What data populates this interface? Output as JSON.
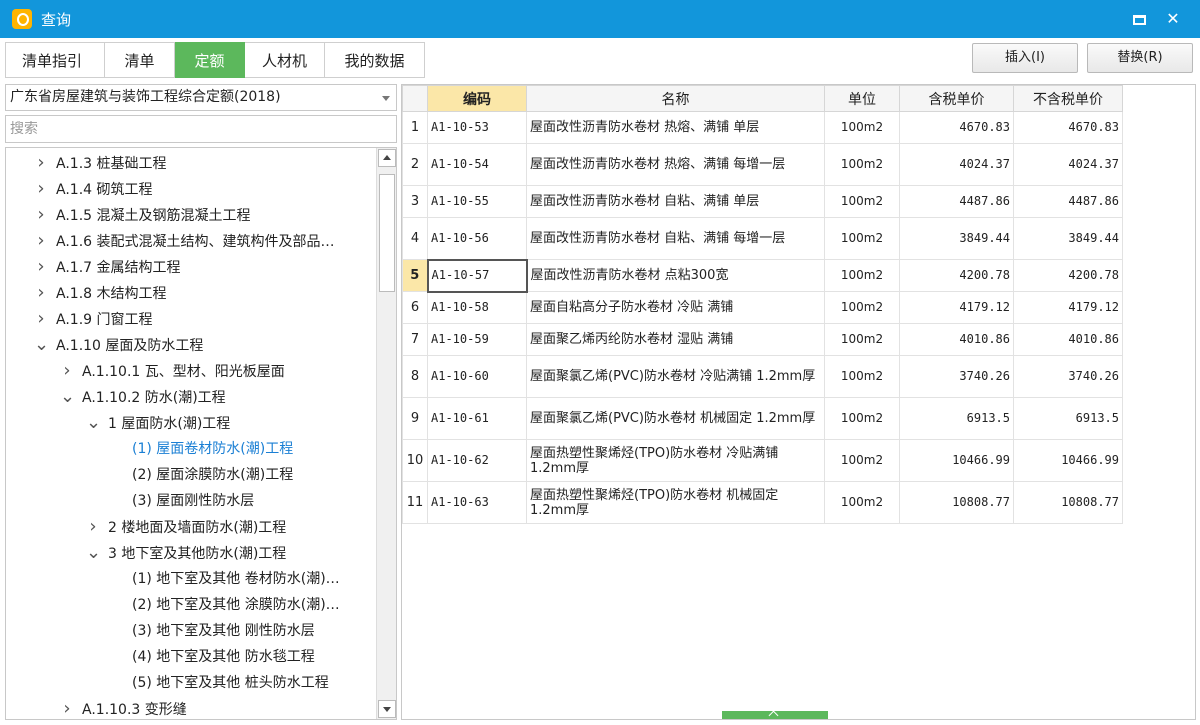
{
  "window": {
    "title": "查询"
  },
  "tabs": [
    {
      "label": "清单指引",
      "active": false
    },
    {
      "label": "清单",
      "active": false
    },
    {
      "label": "定额",
      "active": true
    },
    {
      "label": "人材机",
      "active": false
    },
    {
      "label": "我的数据",
      "active": false
    }
  ],
  "toolbar": {
    "insert_label": "插入(I)",
    "replace_label": "替换(R)"
  },
  "left": {
    "library": "广东省房屋建筑与装饰工程综合定额(2018)",
    "search_placeholder": "搜索",
    "tree": [
      {
        "label": "A.1.3 桩基础工程",
        "state": "collapsed"
      },
      {
        "label": "A.1.4 砌筑工程",
        "state": "collapsed"
      },
      {
        "label": "A.1.5 混凝土及钢筋混凝土工程",
        "state": "collapsed"
      },
      {
        "label": "A.1.6 装配式混凝土结构、建筑构件及部品…",
        "state": "collapsed"
      },
      {
        "label": "A.1.7 金属结构工程",
        "state": "collapsed"
      },
      {
        "label": "A.1.8 木结构工程",
        "state": "collapsed"
      },
      {
        "label": "A.1.9 门窗工程",
        "state": "collapsed"
      },
      {
        "label": "A.1.10 屋面及防水工程",
        "state": "expanded"
      },
      {
        "label": "A.1.10.1 瓦、型材、阳光板屋面",
        "state": "collapsed"
      },
      {
        "label": "A.1.10.2 防水(潮)工程",
        "state": "expanded"
      },
      {
        "label": "1 屋面防水(潮)工程",
        "state": "expanded"
      },
      {
        "label": "(1) 屋面卷材防水(潮)工程",
        "state": "leaf",
        "selected": true
      },
      {
        "label": "(2) 屋面涂膜防水(潮)工程",
        "state": "leaf"
      },
      {
        "label": "(3) 屋面刚性防水层",
        "state": "leaf"
      },
      {
        "label": "2 楼地面及墙面防水(潮)工程",
        "state": "collapsed"
      },
      {
        "label": "3 地下室及其他防水(潮)工程",
        "state": "expanded"
      },
      {
        "label": "(1) 地下室及其他 卷材防水(潮)…",
        "state": "leaf"
      },
      {
        "label": "(2) 地下室及其他 涂膜防水(潮)…",
        "state": "leaf"
      },
      {
        "label": "(3) 地下室及其他 刚性防水层",
        "state": "leaf"
      },
      {
        "label": "(4) 地下室及其他 防水毯工程",
        "state": "leaf"
      },
      {
        "label": "(5) 地下室及其他 桩头防水工程",
        "state": "leaf"
      },
      {
        "label": "A.1.10.3 变形缝",
        "state": "collapsed"
      }
    ]
  },
  "table": {
    "headers": [
      "",
      "编码",
      "名称",
      "单位",
      "含税单价",
      "不含税单价"
    ],
    "rows": [
      {
        "n": "1",
        "code": "A1-10-53",
        "name": "屋面改性沥青防水卷材 热熔、满铺 单层",
        "unit": "100m2",
        "tax": "4670.83",
        "notax": "4670.83"
      },
      {
        "n": "2",
        "code": "A1-10-54",
        "name": "屋面改性沥青防水卷材 热熔、满铺 每增一层",
        "unit": "100m2",
        "tax": "4024.37",
        "notax": "4024.37"
      },
      {
        "n": "3",
        "code": "A1-10-55",
        "name": "屋面改性沥青防水卷材 自粘、满铺 单层",
        "unit": "100m2",
        "tax": "4487.86",
        "notax": "4487.86"
      },
      {
        "n": "4",
        "code": "A1-10-56",
        "name": "屋面改性沥青防水卷材 自粘、满铺 每增一层",
        "unit": "100m2",
        "tax": "3849.44",
        "notax": "3849.44"
      },
      {
        "n": "5",
        "code": "A1-10-57",
        "name": "屋面改性沥青防水卷材 点粘300宽",
        "unit": "100m2",
        "tax": "4200.78",
        "notax": "4200.78",
        "current": true
      },
      {
        "n": "6",
        "code": "A1-10-58",
        "name": "屋面自粘高分子防水卷材 冷贴 满铺",
        "unit": "100m2",
        "tax": "4179.12",
        "notax": "4179.12"
      },
      {
        "n": "7",
        "code": "A1-10-59",
        "name": "屋面聚乙烯丙纶防水卷材 湿贴 满铺",
        "unit": "100m2",
        "tax": "4010.86",
        "notax": "4010.86"
      },
      {
        "n": "8",
        "code": "A1-10-60",
        "name": "屋面聚氯乙烯(PVC)防水卷材 冷贴满铺 1.2mm厚",
        "unit": "100m2",
        "tax": "3740.26",
        "notax": "3740.26"
      },
      {
        "n": "9",
        "code": "A1-10-61",
        "name": "屋面聚氯乙烯(PVC)防水卷材 机械固定 1.2mm厚",
        "unit": "100m2",
        "tax": "6913.5",
        "notax": "6913.5"
      },
      {
        "n": "10",
        "code": "A1-10-62",
        "name": "屋面热塑性聚烯烃(TPO)防水卷材 冷贴满铺 1.2mm厚",
        "unit": "100m2",
        "tax": "10466.99",
        "notax": "10466.99"
      },
      {
        "n": "11",
        "code": "A1-10-63",
        "name": "屋面热塑性聚烯烃(TPO)防水卷材 机械固定 1.2mm厚",
        "unit": "100m2",
        "tax": "10808.77",
        "notax": "10808.77"
      }
    ]
  },
  "colors": {
    "titlebar": "#1296db",
    "active_tab": "#5cb85c",
    "highlight": "#fbe7a8",
    "selected_text": "#1a7fd4"
  }
}
